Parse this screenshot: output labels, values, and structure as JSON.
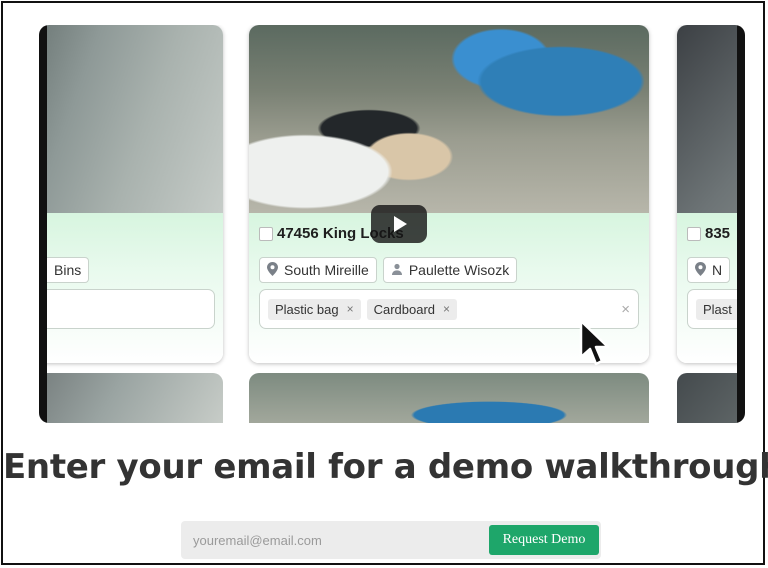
{
  "video": {
    "left_card": {
      "chip_label": "Bins"
    },
    "center_card": {
      "address": "47456 King Locks",
      "location": "South Mireille",
      "person": "Paulette Wisozk",
      "tags": [
        "Plastic bag",
        "Cardboard"
      ],
      "tag_remove_symbol": "×",
      "clear_symbol": "×"
    },
    "right_card": {
      "address_fragment": "835",
      "location_fragment": "N",
      "tag_fragment": "Plast"
    }
  },
  "cta": {
    "headline": "Enter your email for a demo walkthrough",
    "email_placeholder": "youremail@email.com",
    "button_label": "Request Demo",
    "button_color": "#1ea66a"
  },
  "icons": {
    "play": "play-icon",
    "cursor": "mouse-cursor-icon",
    "location": "map-pin-icon",
    "person": "person-icon"
  }
}
